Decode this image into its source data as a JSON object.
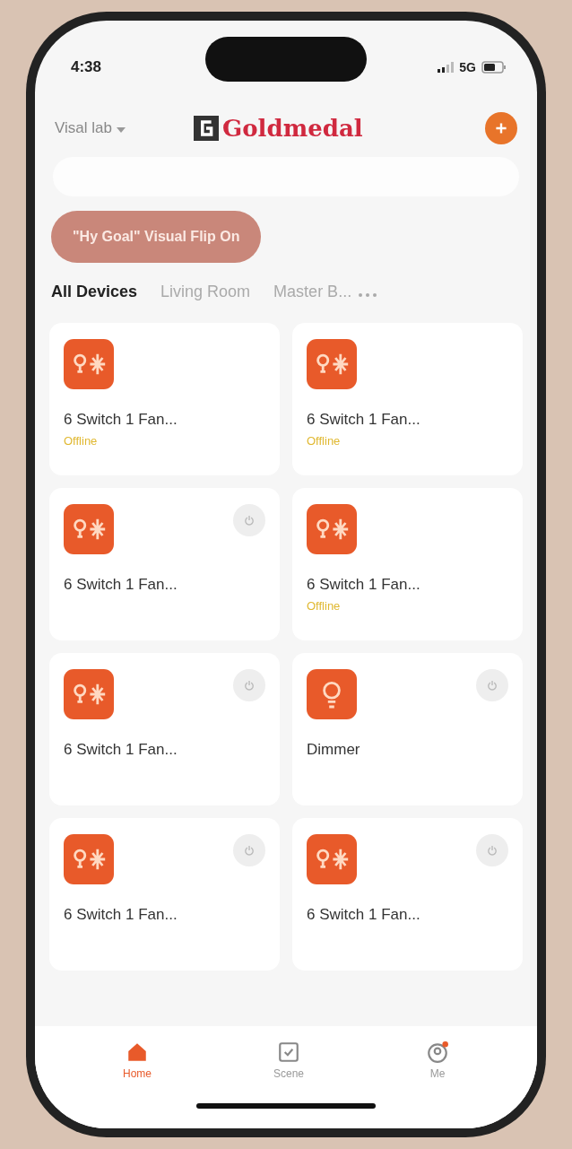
{
  "status_bar": {
    "time": "4:38",
    "network": "5G"
  },
  "header": {
    "home_name": "Visal lab",
    "logo": "Goldmedal"
  },
  "banner": {
    "label": "\"Hy Goal\" Visual Flip On"
  },
  "tabs": [
    {
      "label": "All Devices",
      "selected": true
    },
    {
      "label": "Living Room",
      "selected": false
    },
    {
      "label": "Master B...",
      "selected": false
    }
  ],
  "devices": [
    {
      "name": "6 Switch 1 Fan...",
      "kind": "switch",
      "offline": true,
      "status": "Offline"
    },
    {
      "name": "6 Switch 1 Fan...",
      "kind": "switch",
      "offline": true,
      "status": "Offline"
    },
    {
      "name": "6 Switch 1 Fan...",
      "kind": "switch",
      "offline": false
    },
    {
      "name": "6 Switch 1 Fan...",
      "kind": "switch",
      "offline": true,
      "status": "Offline"
    },
    {
      "name": "6 Switch 1 Fan...",
      "kind": "switch",
      "offline": false
    },
    {
      "name": "Dimmer",
      "kind": "dimmer",
      "offline": false
    },
    {
      "name": "6 Switch 1 Fan...",
      "kind": "switch",
      "offline": false
    },
    {
      "name": "6 Switch 1 Fan...",
      "kind": "switch",
      "offline": false
    }
  ],
  "nav": [
    {
      "label": "Home",
      "kind": "home",
      "selected": true
    },
    {
      "label": "Scene",
      "kind": "scene",
      "selected": false
    },
    {
      "label": "Me",
      "kind": "me",
      "selected": false
    }
  ]
}
